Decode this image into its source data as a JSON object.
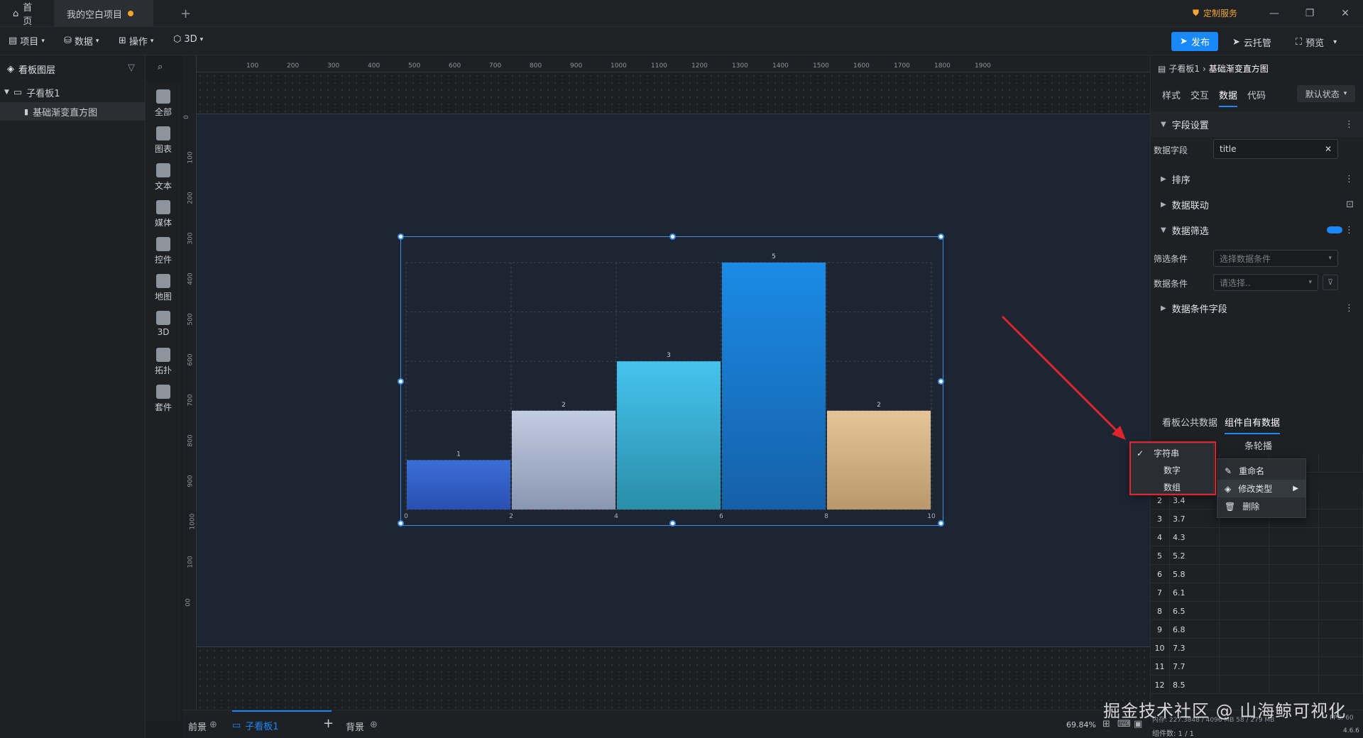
{
  "tabs": {
    "home": "首页",
    "project": "我的空白项目",
    "add": "+"
  },
  "title_right": {
    "custom_service": "定制服务"
  },
  "window": {
    "minimize": "—",
    "restore": "❐",
    "close": "✕"
  },
  "menus": [
    "项目",
    "数据",
    "操作",
    "3D"
  ],
  "top_actions": {
    "publish": "发布",
    "cloud": "云托管",
    "preview": "预览"
  },
  "layers": {
    "title": "看板图层",
    "board": "子看板1",
    "item": "基础渐变直方图"
  },
  "tools": [
    "全部",
    "图表",
    "文本",
    "媒体",
    "控件",
    "地图",
    "3D",
    "拓扑",
    "套件"
  ],
  "ruler_x": [
    "100",
    "200",
    "300",
    "400",
    "500",
    "600",
    "700",
    "800",
    "900",
    "1000",
    "1100",
    "1200",
    "1300",
    "1400",
    "1500",
    "1600",
    "1700",
    "1800",
    "1900"
  ],
  "ruler_y": [
    "0",
    "100",
    "200",
    "300",
    "400",
    "500",
    "600",
    "700",
    "800",
    "900",
    "1000",
    "100",
    "00"
  ],
  "chart_data": {
    "type": "bar",
    "x_ticks": [
      "0",
      "2",
      "4",
      "6",
      "8",
      "10"
    ],
    "bins": [
      {
        "x0": 0,
        "x1": 2,
        "value": 1,
        "label": "1",
        "color_top": "#3a6fd8",
        "color_bottom": "#2a4fb0"
      },
      {
        "x0": 2,
        "x1": 4,
        "value": 2,
        "label": "2",
        "color_top": "#c2cde3",
        "color_bottom": "#8a96b0"
      },
      {
        "x0": 4,
        "x1": 6,
        "value": 3,
        "label": "3",
        "color_top": "#45c3ee",
        "color_bottom": "#2a8ea8"
      },
      {
        "x0": 6,
        "x1": 8,
        "value": 5,
        "label": "5",
        "color_top": "#1b8be6",
        "color_bottom": "#1560a8"
      },
      {
        "x0": 8,
        "x1": 10,
        "value": 2,
        "label": "2",
        "color_top": "#e6c49a",
        "color_bottom": "#b9986e"
      }
    ],
    "ylim": [
      0,
      5
    ],
    "grid": true
  },
  "breadcrumb": {
    "parent": "子看板1",
    "sep": "›",
    "current": "基础渐变直方图"
  },
  "prop_tabs": [
    "样式",
    "交互",
    "数据",
    "代码"
  ],
  "state_select": "默认状态",
  "sections": {
    "field_settings": "字段设置",
    "data_field_label": "数据字段",
    "data_field_value": "title",
    "sort": "排序",
    "linkage": "数据联动",
    "filter": "数据筛选",
    "filter_cond_label": "筛选条件",
    "filter_cond_placeholder": "选择数据条件",
    "data_cond_label": "数据条件",
    "data_cond_placeholder": "请选择..",
    "cond_field": "数据条件字段"
  },
  "data_tabs": [
    "看板公共数据",
    "组件自有数据"
  ],
  "carousel_label": "条轮播",
  "table_rows": [
    {
      "idx": "2",
      "val": "3.4"
    },
    {
      "idx": "3",
      "val": "3.7"
    },
    {
      "idx": "4",
      "val": "4.3"
    },
    {
      "idx": "5",
      "val": "5.2"
    },
    {
      "idx": "6",
      "val": "5.8"
    },
    {
      "idx": "7",
      "val": "6.1"
    },
    {
      "idx": "8",
      "val": "6.5"
    },
    {
      "idx": "9",
      "val": "6.8"
    },
    {
      "idx": "10",
      "val": "7.3"
    },
    {
      "idx": "11",
      "val": "7.7"
    },
    {
      "idx": "12",
      "val": "8.5"
    }
  ],
  "type_menu": {
    "check": "✓",
    "items": [
      "字符串",
      "数字",
      "数组"
    ]
  },
  "col_menu": {
    "rename": "重命名",
    "change_type": "修改类型",
    "delete": "删除"
  },
  "bottom": {
    "front": "前景",
    "board": "子看板1",
    "add": "+",
    "background": "背景",
    "zoom": "69.84%",
    "version": "4.6.6",
    "fps": "FPS: 60",
    "mem": "内存: 227.3848 / 4096 MB  58 / 279 MB",
    "count": "组件数: 1 / 1"
  },
  "watermark": "掘金技术社区 @ 山海鲸可视化"
}
